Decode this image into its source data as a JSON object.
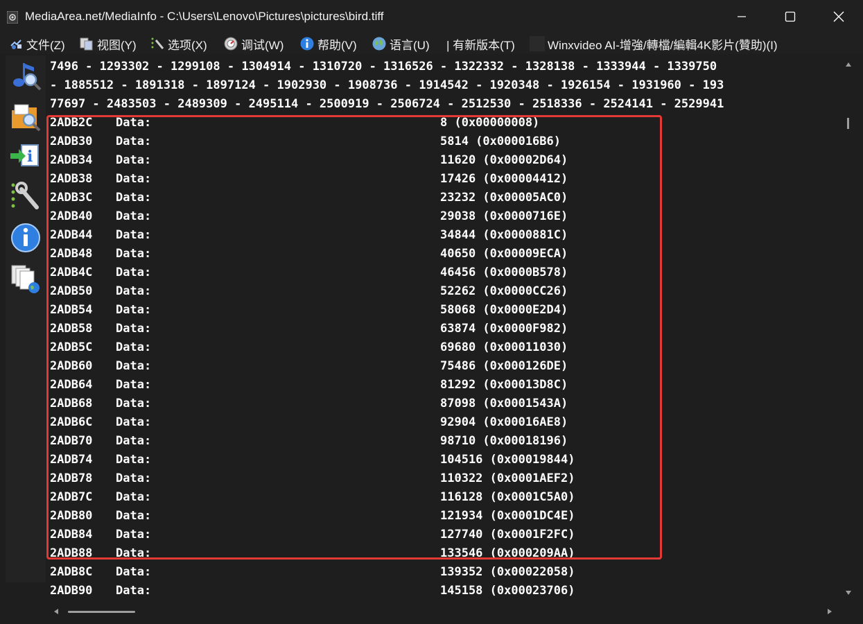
{
  "window": {
    "title": "MediaArea.net/MediaInfo - C:\\Users\\Lenovo\\Pictures\\pictures\\bird.tiff",
    "app_icon": "speaker-icon",
    "controls": [
      "minimize-icon",
      "maximize-icon",
      "close-icon"
    ]
  },
  "menu": [
    {
      "label": "文件(Z)",
      "icon": "file-icon"
    },
    {
      "label": "视图(Y)",
      "icon": "view-icon"
    },
    {
      "label": "选项(X)",
      "icon": "tools-icon"
    },
    {
      "label": "调试(W)",
      "icon": "debug-icon"
    },
    {
      "label": "帮助(V)",
      "icon": "info-icon"
    },
    {
      "label": "语言(U)",
      "icon": "globe-icon"
    },
    {
      "label": "| 有新版本(T)",
      "icon": ""
    },
    {
      "label": "Winxvideo AI-增強/轉檔/編輯4K影片(贊助)(I)",
      "icon": "sponsor-icon"
    }
  ],
  "sidebar": [
    {
      "name": "open-file",
      "icon": "music-search-icon"
    },
    {
      "name": "open-folder",
      "icon": "folder-search-icon"
    },
    {
      "name": "export",
      "icon": "export-info-icon"
    },
    {
      "name": "preferences",
      "icon": "wrench-icon"
    },
    {
      "name": "about",
      "icon": "info-circle-icon"
    },
    {
      "name": "web",
      "icon": "web-docs-icon"
    }
  ],
  "content": {
    "top_lines": [
      "7496 - 1293302 - 1299108 - 1304914 - 1310720 - 1316526 - 1322332 - 1328138 - 1333944 - 1339750",
      "- 1885512 - 1891318 - 1897124 - 1902930 - 1908736 - 1914542 - 1920348 - 1926154 - 1931960 - 193",
      "77697 - 2483503 - 2489309 - 2495114 - 2500919 - 2506724 - 2512530 - 2518336 - 2524141 - 2529941"
    ],
    "rows": [
      {
        "addr": "2ADB2C",
        "label": "Data:",
        "value": "8 (0x00000008)"
      },
      {
        "addr": "2ADB30",
        "label": "Data:",
        "value": "5814 (0x000016B6)"
      },
      {
        "addr": "2ADB34",
        "label": "Data:",
        "value": "11620 (0x00002D64)"
      },
      {
        "addr": "2ADB38",
        "label": "Data:",
        "value": "17426 (0x00004412)"
      },
      {
        "addr": "2ADB3C",
        "label": "Data:",
        "value": "23232 (0x00005AC0)"
      },
      {
        "addr": "2ADB40",
        "label": "Data:",
        "value": "29038 (0x0000716E)"
      },
      {
        "addr": "2ADB44",
        "label": "Data:",
        "value": "34844 (0x0000881C)"
      },
      {
        "addr": "2ADB48",
        "label": "Data:",
        "value": "40650 (0x00009ECA)"
      },
      {
        "addr": "2ADB4C",
        "label": "Data:",
        "value": "46456 (0x0000B578)"
      },
      {
        "addr": "2ADB50",
        "label": "Data:",
        "value": "52262 (0x0000CC26)"
      },
      {
        "addr": "2ADB54",
        "label": "Data:",
        "value": "58068 (0x0000E2D4)"
      },
      {
        "addr": "2ADB58",
        "label": "Data:",
        "value": "63874 (0x0000F982)"
      },
      {
        "addr": "2ADB5C",
        "label": "Data:",
        "value": "69680 (0x00011030)"
      },
      {
        "addr": "2ADB60",
        "label": "Data:",
        "value": "75486 (0x000126DE)"
      },
      {
        "addr": "2ADB64",
        "label": "Data:",
        "value": "81292 (0x00013D8C)"
      },
      {
        "addr": "2ADB68",
        "label": "Data:",
        "value": "87098 (0x0001543A)"
      },
      {
        "addr": "2ADB6C",
        "label": "Data:",
        "value": "92904 (0x00016AE8)"
      },
      {
        "addr": "2ADB70",
        "label": "Data:",
        "value": "98710 (0x00018196)"
      },
      {
        "addr": "2ADB74",
        "label": "Data:",
        "value": "104516 (0x00019844)"
      },
      {
        "addr": "2ADB78",
        "label": "Data:",
        "value": "110322 (0x0001AEF2)"
      },
      {
        "addr": "2ADB7C",
        "label": "Data:",
        "value": "116128 (0x0001C5A0)"
      },
      {
        "addr": "2ADB80",
        "label": "Data:",
        "value": "121934 (0x0001DC4E)"
      },
      {
        "addr": "2ADB84",
        "label": "Data:",
        "value": "127740 (0x0001F2FC)"
      },
      {
        "addr": "2ADB88",
        "label": "Data:",
        "value": "133546 (0x000209AA)"
      },
      {
        "addr": "2ADB8C",
        "label": "Data:",
        "value": "139352 (0x00022058)"
      },
      {
        "addr": "2ADB90",
        "label": "Data:",
        "value": "145158 (0x00023706)"
      }
    ]
  },
  "colors": {
    "background": "#1e1e1e",
    "titlebar": "#202020",
    "text": "#ffffff",
    "highlight_border": "#e53935"
  }
}
